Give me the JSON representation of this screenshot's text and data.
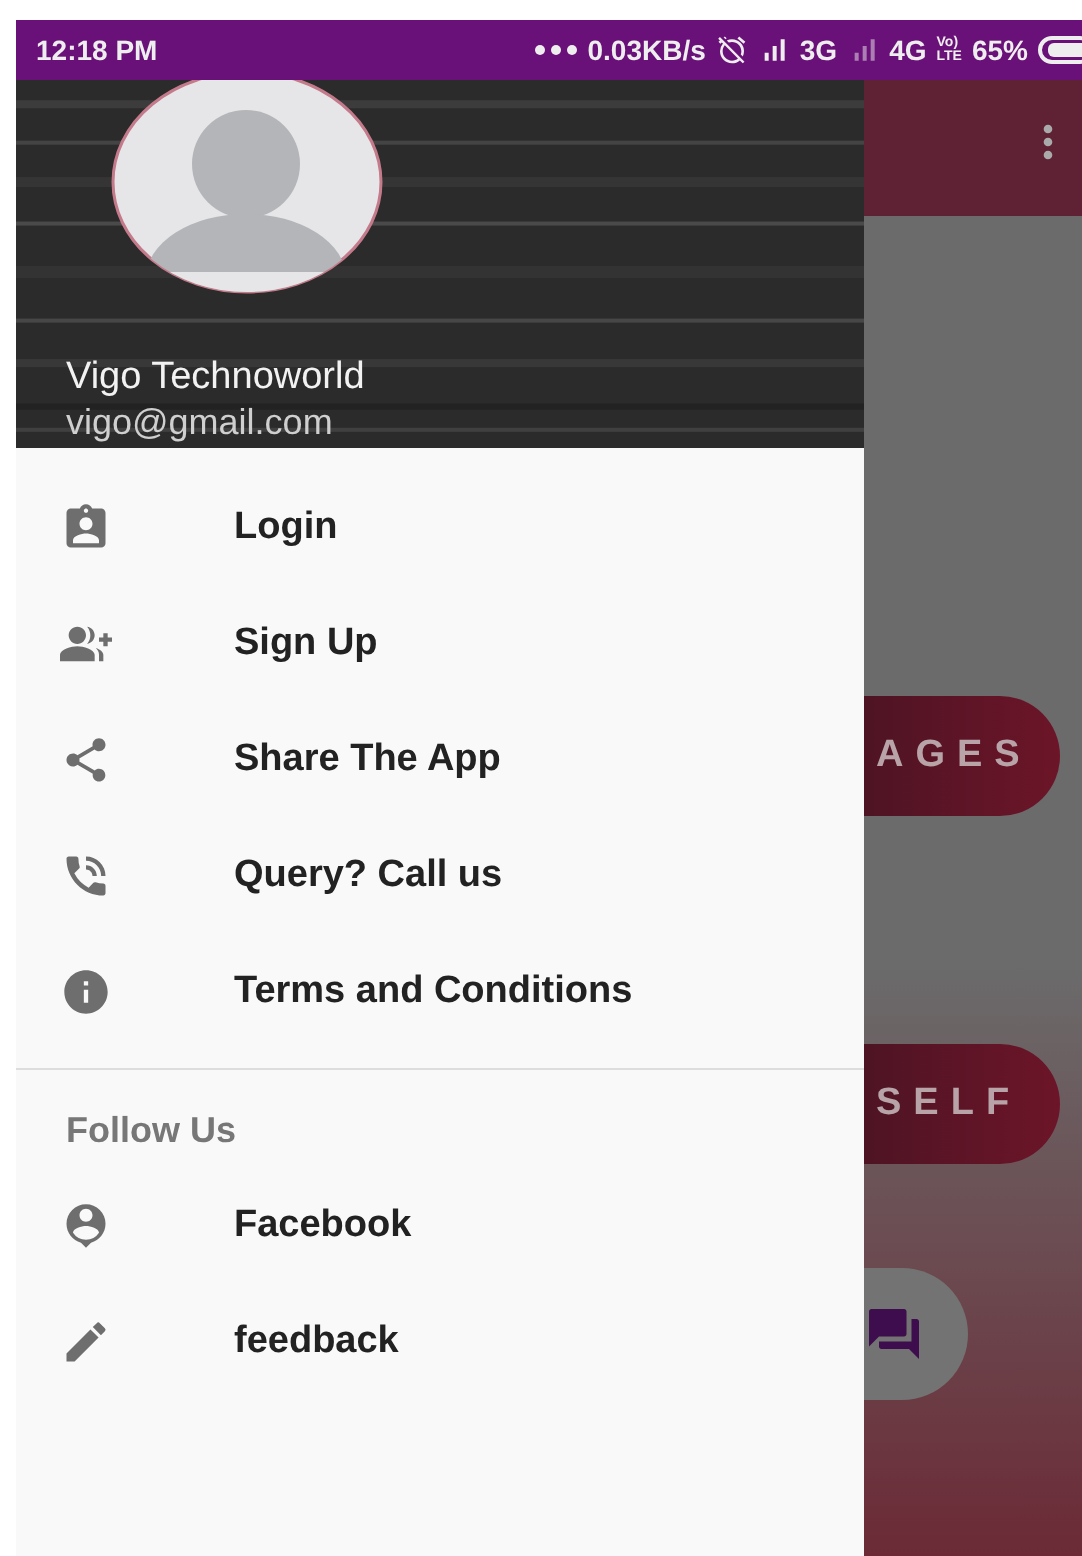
{
  "status_bar": {
    "time": "12:18 PM",
    "speed": "0.03KB/s",
    "network_1": "3G",
    "network_2": "4G",
    "volte": [
      "Vo)",
      "LTE"
    ],
    "battery": "65%"
  },
  "drawer": {
    "user": {
      "name": "Vigo Technoworld",
      "email": "vigo@gmail.com"
    },
    "items": [
      {
        "label": "Login"
      },
      {
        "label": "Sign Up"
      },
      {
        "label": "Share The App"
      },
      {
        "label": "Query? Call us"
      },
      {
        "label": "Terms and Conditions"
      }
    ],
    "section": {
      "title": "Follow Us",
      "items": [
        {
          "label": "Facebook"
        },
        {
          "label": "feedback"
        }
      ]
    }
  },
  "app_behind": {
    "buttons": [
      "AGES",
      "SELF"
    ]
  }
}
